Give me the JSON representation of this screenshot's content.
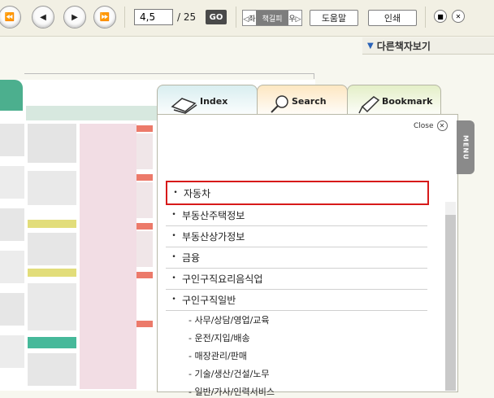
{
  "toolbar": {
    "page_current": "4,5",
    "page_total": "/ 25",
    "go_label": "GO",
    "direction_left": "◁좌",
    "direction_mid": "책길피",
    "direction_right": "우▷",
    "help_label": "도움말",
    "print_label": "인쇄"
  },
  "other_books": "다른책자보기",
  "tabs": {
    "index": "Index",
    "search": "Search",
    "bookmark": "Bookmark"
  },
  "panel": {
    "close_label": "Close",
    "menu_label": "MENU"
  },
  "index_items": [
    "자동차",
    "부동산주택정보",
    "부동산상가정보",
    "금융",
    "구인구직요리음식업",
    "구인구직일반"
  ],
  "sub_items": [
    "- 사무/상담/영업/교육",
    "- 운전/지입/배송",
    "- 매장관리/판매",
    "- 기술/생산/건설/노무",
    "- 일반/가사/인력서비스"
  ]
}
